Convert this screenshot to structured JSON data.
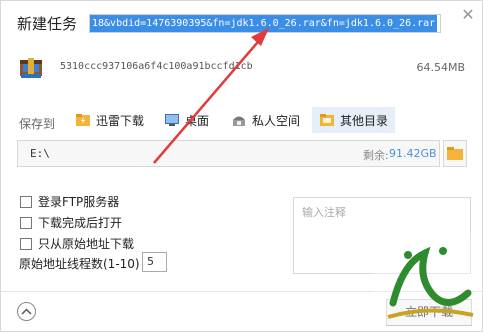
{
  "dialog": {
    "title": "新建任务",
    "close_icon": "close-icon",
    "url_value": "18&vbdid=1476390395&fn=jdk1.6.0_26.rar&fn=jdk1.6.0_26.rar"
  },
  "file": {
    "icon": "rar-archive-icon",
    "hash": "5310ccc937106a6f4c100a91bccfd1cb",
    "size": "64.54MB"
  },
  "save_to": {
    "label": "保存到",
    "locations": [
      {
        "label": "迅雷下载",
        "icon": "thunder-folder-icon"
      },
      {
        "label": "桌面",
        "icon": "desktop-icon"
      },
      {
        "label": "私人空间",
        "icon": "private-space-icon"
      },
      {
        "label": "其他目录",
        "icon": "other-folder-icon",
        "active": true
      }
    ],
    "path": "E:\\",
    "free_label": "剩余:",
    "free_value": "91.42GB"
  },
  "options": {
    "login_ftp": "登录FTP服务器",
    "open_after": "下载完成后打开",
    "only_origin": "只从原始地址下载",
    "threads_label": "原始地址线程数(1-10)",
    "threads_value": "5"
  },
  "note": {
    "placeholder": "输入注释"
  },
  "footer": {
    "download_label": "立即下载"
  },
  "colors": {
    "selection": "#3a8ee6",
    "free_value": "#4a90d9",
    "active_tab": "#e6eef8",
    "annotation_arrow": "#e23b3b"
  }
}
